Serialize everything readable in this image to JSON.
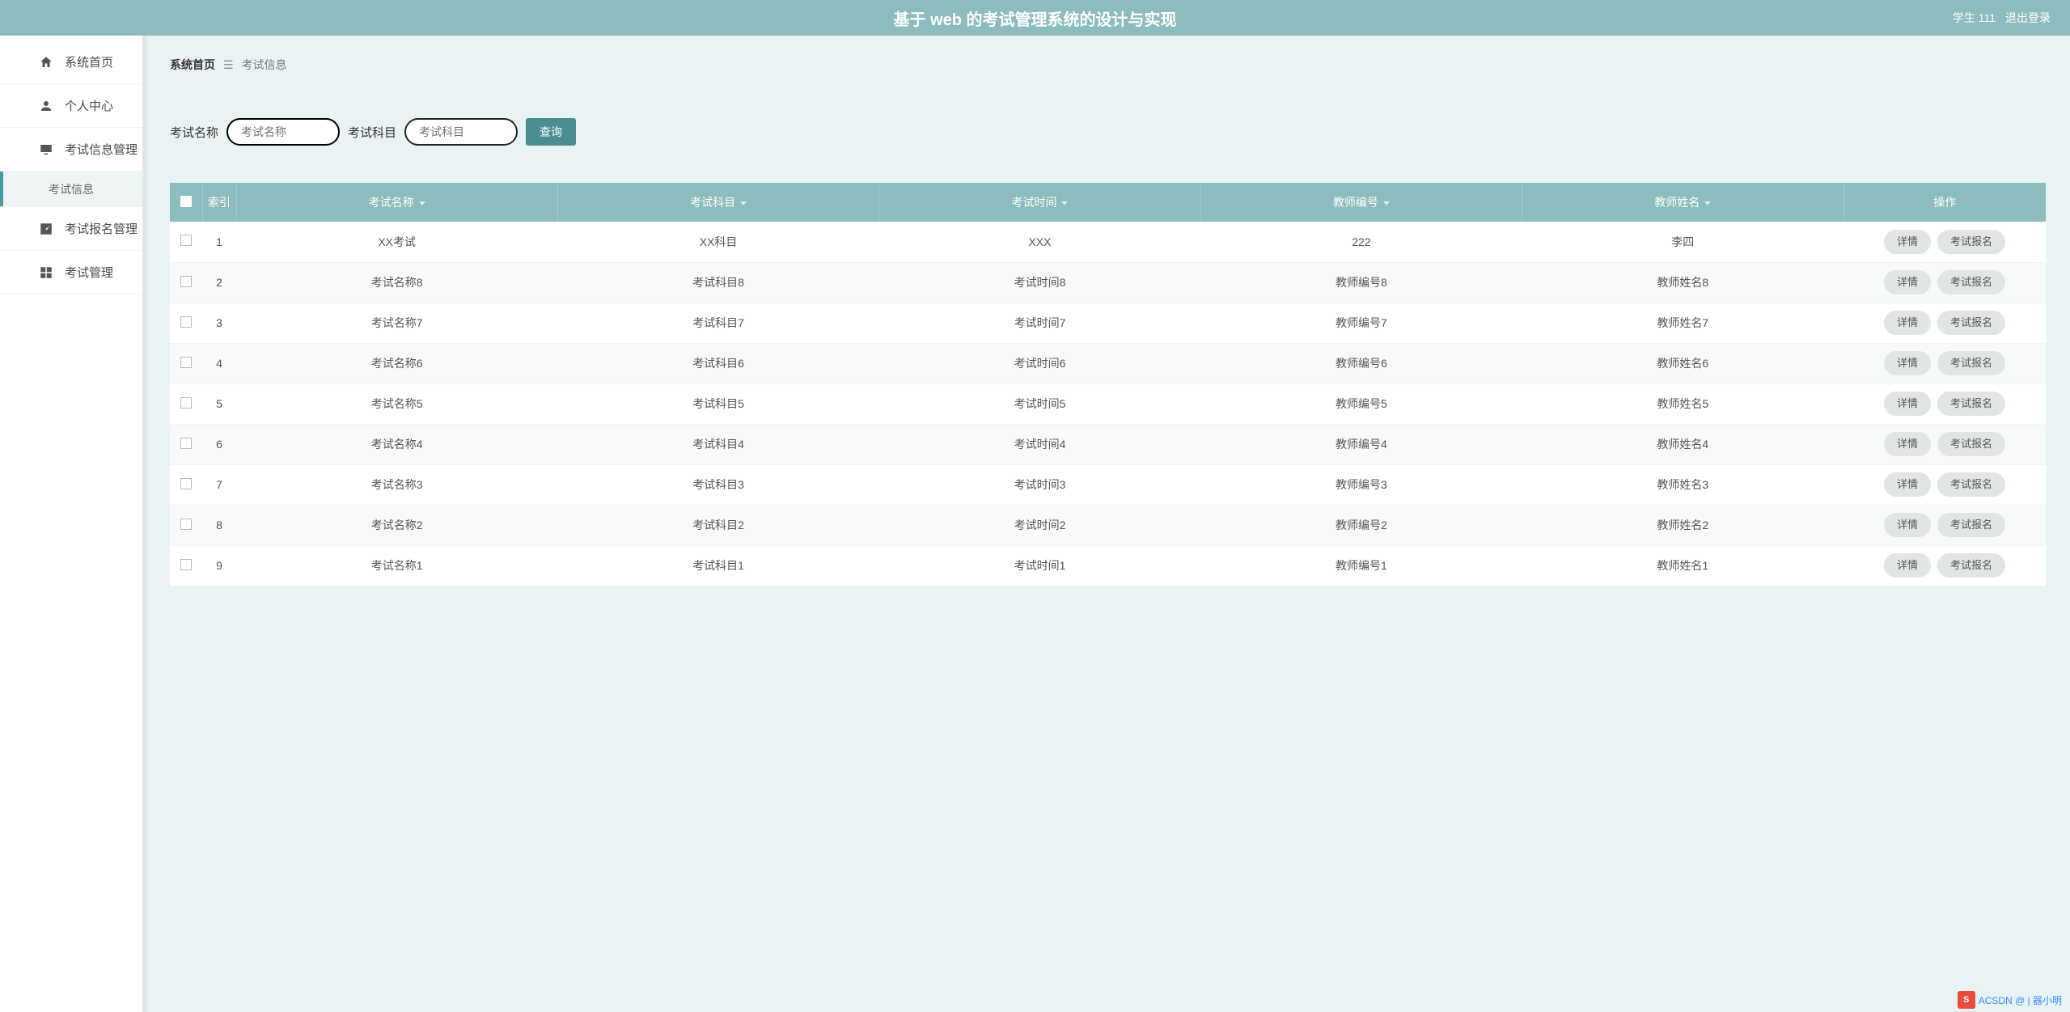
{
  "header": {
    "title": "基于 web 的考试管理系统的设计与实现",
    "user_label": "学生 111",
    "logout_label": "退出登录"
  },
  "sidebar": {
    "items": [
      {
        "label": "系统首页",
        "icon": "home-icon"
      },
      {
        "label": "个人中心",
        "icon": "person-icon"
      },
      {
        "label": "考试信息管理",
        "icon": "monitor-icon"
      },
      {
        "label": "考试信息",
        "icon": "",
        "child": true,
        "active": true
      },
      {
        "label": "考试报名管理",
        "icon": "chart-icon"
      },
      {
        "label": "考试管理",
        "icon": "grid-icon"
      }
    ]
  },
  "breadcrumb": {
    "home": "系统首页",
    "sep": "☰",
    "current": "考试信息"
  },
  "filter": {
    "label1": "考试名称",
    "placeholder1": "考试名称",
    "label2": "考试科目",
    "placeholder2": "考试科目",
    "search_label": "查询"
  },
  "table": {
    "headers": [
      "",
      "索引",
      "考试名称",
      "考试科目",
      "考试时间",
      "教师编号",
      "教师姓名",
      "操作"
    ],
    "op_detail": "详情",
    "op_signup": "考试报名",
    "rows": [
      {
        "idx": "1",
        "name": "XX考试",
        "subject": "XX科目",
        "time": "XXX",
        "tno": "222",
        "tname": "李四"
      },
      {
        "idx": "2",
        "name": "考试名称8",
        "subject": "考试科目8",
        "time": "考试时间8",
        "tno": "教师编号8",
        "tname": "教师姓名8"
      },
      {
        "idx": "3",
        "name": "考试名称7",
        "subject": "考试科目7",
        "time": "考试时间7",
        "tno": "教师编号7",
        "tname": "教师姓名7"
      },
      {
        "idx": "4",
        "name": "考试名称6",
        "subject": "考试科目6",
        "time": "考试时间6",
        "tno": "教师编号6",
        "tname": "教师姓名6"
      },
      {
        "idx": "5",
        "name": "考试名称5",
        "subject": "考试科目5",
        "time": "考试时间5",
        "tno": "教师编号5",
        "tname": "教师姓名5"
      },
      {
        "idx": "6",
        "name": "考试名称4",
        "subject": "考试科目4",
        "time": "考试时间4",
        "tno": "教师编号4",
        "tname": "教师姓名4"
      },
      {
        "idx": "7",
        "name": "考试名称3",
        "subject": "考试科目3",
        "time": "考试时间3",
        "tno": "教师编号3",
        "tname": "教师姓名3"
      },
      {
        "idx": "8",
        "name": "考试名称2",
        "subject": "考试科目2",
        "time": "考试时间2",
        "tno": "教师编号2",
        "tname": "教师姓名2"
      },
      {
        "idx": "9",
        "name": "考试名称1",
        "subject": "考试科目1",
        "time": "考试时间1",
        "tno": "教师编号1",
        "tname": "教师姓名1"
      }
    ]
  },
  "tray": {
    "s": "S",
    "a": "A",
    "text": "ACSDN @ | 器小明"
  }
}
